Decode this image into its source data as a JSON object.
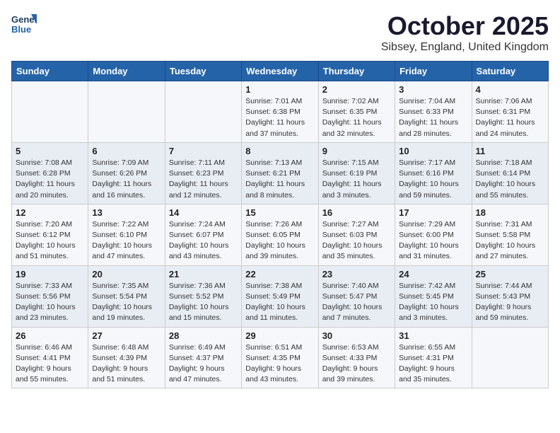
{
  "header": {
    "logo_line1": "General",
    "logo_line2": "Blue",
    "month": "October 2025",
    "location": "Sibsey, England, United Kingdom"
  },
  "days_of_week": [
    "Sunday",
    "Monday",
    "Tuesday",
    "Wednesday",
    "Thursday",
    "Friday",
    "Saturday"
  ],
  "weeks": [
    [
      {
        "num": "",
        "sunrise": "",
        "sunset": "",
        "daylight": ""
      },
      {
        "num": "",
        "sunrise": "",
        "sunset": "",
        "daylight": ""
      },
      {
        "num": "",
        "sunrise": "",
        "sunset": "",
        "daylight": ""
      },
      {
        "num": "1",
        "sunrise": "Sunrise: 7:01 AM",
        "sunset": "Sunset: 6:38 PM",
        "daylight": "Daylight: 11 hours and 37 minutes."
      },
      {
        "num": "2",
        "sunrise": "Sunrise: 7:02 AM",
        "sunset": "Sunset: 6:35 PM",
        "daylight": "Daylight: 11 hours and 32 minutes."
      },
      {
        "num": "3",
        "sunrise": "Sunrise: 7:04 AM",
        "sunset": "Sunset: 6:33 PM",
        "daylight": "Daylight: 11 hours and 28 minutes."
      },
      {
        "num": "4",
        "sunrise": "Sunrise: 7:06 AM",
        "sunset": "Sunset: 6:31 PM",
        "daylight": "Daylight: 11 hours and 24 minutes."
      }
    ],
    [
      {
        "num": "5",
        "sunrise": "Sunrise: 7:08 AM",
        "sunset": "Sunset: 6:28 PM",
        "daylight": "Daylight: 11 hours and 20 minutes."
      },
      {
        "num": "6",
        "sunrise": "Sunrise: 7:09 AM",
        "sunset": "Sunset: 6:26 PM",
        "daylight": "Daylight: 11 hours and 16 minutes."
      },
      {
        "num": "7",
        "sunrise": "Sunrise: 7:11 AM",
        "sunset": "Sunset: 6:23 PM",
        "daylight": "Daylight: 11 hours and 12 minutes."
      },
      {
        "num": "8",
        "sunrise": "Sunrise: 7:13 AM",
        "sunset": "Sunset: 6:21 PM",
        "daylight": "Daylight: 11 hours and 8 minutes."
      },
      {
        "num": "9",
        "sunrise": "Sunrise: 7:15 AM",
        "sunset": "Sunset: 6:19 PM",
        "daylight": "Daylight: 11 hours and 3 minutes."
      },
      {
        "num": "10",
        "sunrise": "Sunrise: 7:17 AM",
        "sunset": "Sunset: 6:16 PM",
        "daylight": "Daylight: 10 hours and 59 minutes."
      },
      {
        "num": "11",
        "sunrise": "Sunrise: 7:18 AM",
        "sunset": "Sunset: 6:14 PM",
        "daylight": "Daylight: 10 hours and 55 minutes."
      }
    ],
    [
      {
        "num": "12",
        "sunrise": "Sunrise: 7:20 AM",
        "sunset": "Sunset: 6:12 PM",
        "daylight": "Daylight: 10 hours and 51 minutes."
      },
      {
        "num": "13",
        "sunrise": "Sunrise: 7:22 AM",
        "sunset": "Sunset: 6:10 PM",
        "daylight": "Daylight: 10 hours and 47 minutes."
      },
      {
        "num": "14",
        "sunrise": "Sunrise: 7:24 AM",
        "sunset": "Sunset: 6:07 PM",
        "daylight": "Daylight: 10 hours and 43 minutes."
      },
      {
        "num": "15",
        "sunrise": "Sunrise: 7:26 AM",
        "sunset": "Sunset: 6:05 PM",
        "daylight": "Daylight: 10 hours and 39 minutes."
      },
      {
        "num": "16",
        "sunrise": "Sunrise: 7:27 AM",
        "sunset": "Sunset: 6:03 PM",
        "daylight": "Daylight: 10 hours and 35 minutes."
      },
      {
        "num": "17",
        "sunrise": "Sunrise: 7:29 AM",
        "sunset": "Sunset: 6:00 PM",
        "daylight": "Daylight: 10 hours and 31 minutes."
      },
      {
        "num": "18",
        "sunrise": "Sunrise: 7:31 AM",
        "sunset": "Sunset: 5:58 PM",
        "daylight": "Daylight: 10 hours and 27 minutes."
      }
    ],
    [
      {
        "num": "19",
        "sunrise": "Sunrise: 7:33 AM",
        "sunset": "Sunset: 5:56 PM",
        "daylight": "Daylight: 10 hours and 23 minutes."
      },
      {
        "num": "20",
        "sunrise": "Sunrise: 7:35 AM",
        "sunset": "Sunset: 5:54 PM",
        "daylight": "Daylight: 10 hours and 19 minutes."
      },
      {
        "num": "21",
        "sunrise": "Sunrise: 7:36 AM",
        "sunset": "Sunset: 5:52 PM",
        "daylight": "Daylight: 10 hours and 15 minutes."
      },
      {
        "num": "22",
        "sunrise": "Sunrise: 7:38 AM",
        "sunset": "Sunset: 5:49 PM",
        "daylight": "Daylight: 10 hours and 11 minutes."
      },
      {
        "num": "23",
        "sunrise": "Sunrise: 7:40 AM",
        "sunset": "Sunset: 5:47 PM",
        "daylight": "Daylight: 10 hours and 7 minutes."
      },
      {
        "num": "24",
        "sunrise": "Sunrise: 7:42 AM",
        "sunset": "Sunset: 5:45 PM",
        "daylight": "Daylight: 10 hours and 3 minutes."
      },
      {
        "num": "25",
        "sunrise": "Sunrise: 7:44 AM",
        "sunset": "Sunset: 5:43 PM",
        "daylight": "Daylight: 9 hours and 59 minutes."
      }
    ],
    [
      {
        "num": "26",
        "sunrise": "Sunrise: 6:46 AM",
        "sunset": "Sunset: 4:41 PM",
        "daylight": "Daylight: 9 hours and 55 minutes."
      },
      {
        "num": "27",
        "sunrise": "Sunrise: 6:48 AM",
        "sunset": "Sunset: 4:39 PM",
        "daylight": "Daylight: 9 hours and 51 minutes."
      },
      {
        "num": "28",
        "sunrise": "Sunrise: 6:49 AM",
        "sunset": "Sunset: 4:37 PM",
        "daylight": "Daylight: 9 hours and 47 minutes."
      },
      {
        "num": "29",
        "sunrise": "Sunrise: 6:51 AM",
        "sunset": "Sunset: 4:35 PM",
        "daylight": "Daylight: 9 hours and 43 minutes."
      },
      {
        "num": "30",
        "sunrise": "Sunrise: 6:53 AM",
        "sunset": "Sunset: 4:33 PM",
        "daylight": "Daylight: 9 hours and 39 minutes."
      },
      {
        "num": "31",
        "sunrise": "Sunrise: 6:55 AM",
        "sunset": "Sunset: 4:31 PM",
        "daylight": "Daylight: 9 hours and 35 minutes."
      },
      {
        "num": "",
        "sunrise": "",
        "sunset": "",
        "daylight": ""
      }
    ]
  ]
}
